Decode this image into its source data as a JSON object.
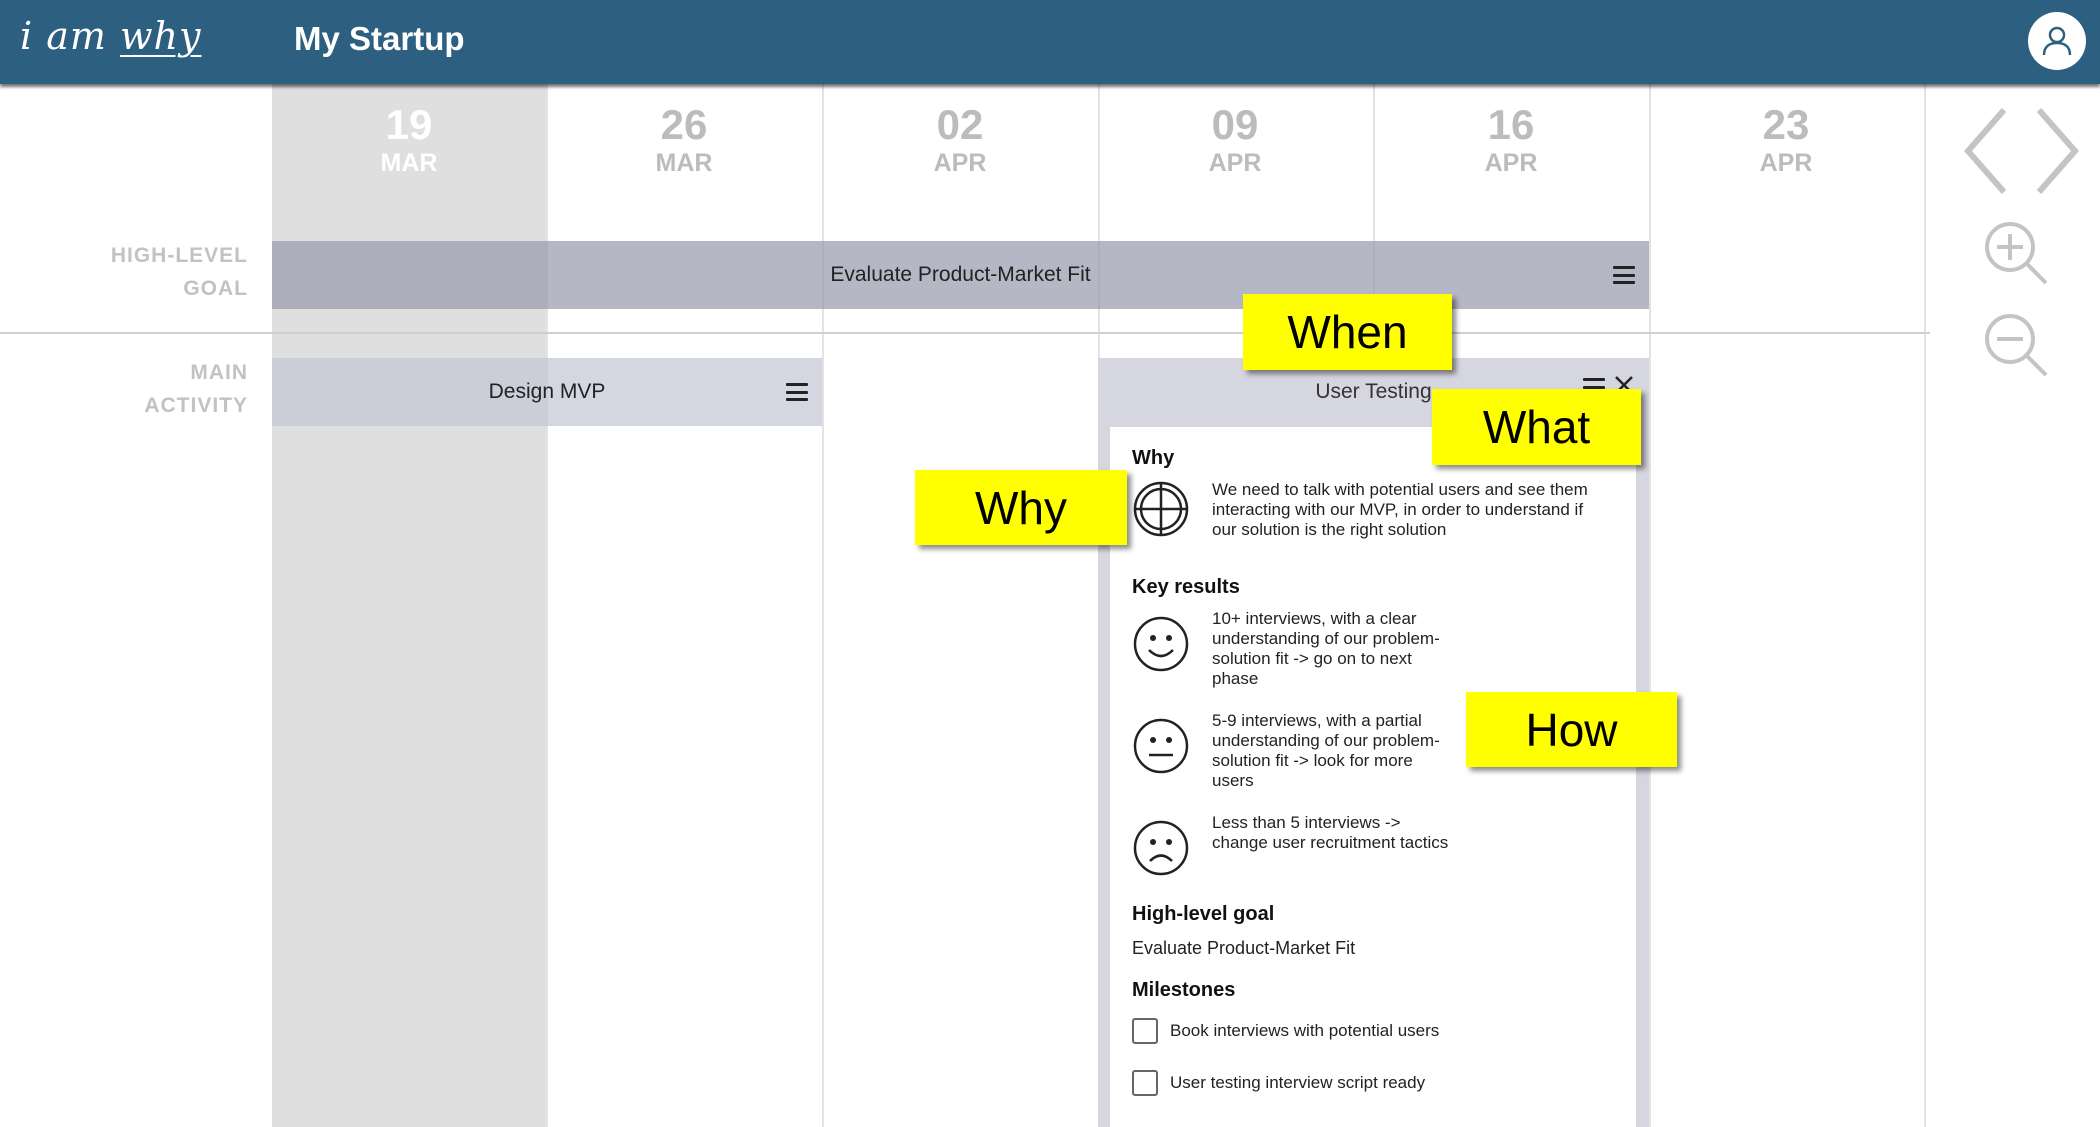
{
  "header": {
    "logo_prefix": "i am ",
    "logo_emphasis": "why",
    "title": "My Startup",
    "avatar_icon": "user-icon"
  },
  "timeline": {
    "columns": [
      {
        "day": "19",
        "month": "MAR",
        "current": true
      },
      {
        "day": "26",
        "month": "MAR"
      },
      {
        "day": "02",
        "month": "APR"
      },
      {
        "day": "09",
        "month": "APR"
      },
      {
        "day": "16",
        "month": "APR"
      },
      {
        "day": "23",
        "month": "APR"
      }
    ],
    "row_labels": {
      "goal_line1": "HIGH-LEVEL",
      "goal_line2": "GOAL",
      "activity_line1": "MAIN",
      "activity_line2": "ACTIVITY"
    }
  },
  "goal_bar": {
    "label": "Evaluate Product-Market Fit",
    "menu_icon": "hamburger-menu-icon"
  },
  "activity_bar": {
    "label": "Design MVP",
    "menu_icon": "hamburger-menu-icon"
  },
  "card": {
    "title": "User Testing",
    "why_heading": "Why",
    "why_icon": "target-crosshair-icon",
    "why_text": "We need to talk with potential users and see them interacting with our MVP, in order to understand if our solution is the right solution",
    "key_results_heading": "Key results",
    "key_results": [
      {
        "icon": "happy-face-icon",
        "text": "10+ interviews, with a clear understanding of our problem-solution fit -> go on to next phase"
      },
      {
        "icon": "neutral-face-icon",
        "text": "5-9 interviews, with a partial understanding of our problem-solution fit -> look for more users"
      },
      {
        "icon": "sad-face-icon",
        "text": "Less than 5 interviews -> change user recruitment tactics"
      }
    ],
    "goal_heading": "High-level goal",
    "goal_value": "Evaluate Product-Market Fit",
    "milestones_heading": "Milestones",
    "milestones": [
      {
        "label": "Book interviews with potential users",
        "checked": false
      },
      {
        "label": "User testing interview script ready",
        "checked": false
      }
    ]
  },
  "callouts": {
    "when": "When",
    "what": "What",
    "why": "Why",
    "how": "How"
  },
  "controls": {
    "prev_icon": "chevron-left-icon",
    "next_icon": "chevron-right-icon",
    "zoom_in_icon": "zoom-in-icon",
    "zoom_out_icon": "zoom-out-icon"
  },
  "colors": {
    "header_bg": "#2c5f80",
    "callout_bg": "#ffff00",
    "current_column": "#dfdfdf",
    "goal_bar": "#b6b7c5",
    "activity_bar": "#d6d6e1"
  }
}
